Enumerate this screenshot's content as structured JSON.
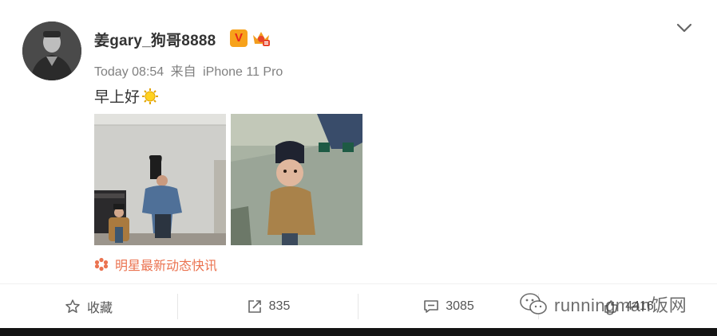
{
  "post": {
    "username": "姜gary_狗哥8888",
    "verified_badge": "V",
    "timestamp": "Today 08:54",
    "source_prefix": "来自",
    "device": "iPhone 11 Pro",
    "text": "早上好",
    "topic_label": "明星最新动态快讯"
  },
  "actions": {
    "favorite_label": "收藏",
    "repost_count": "835",
    "comment_count": "3085",
    "like_count": "4416"
  },
  "watermark": {
    "text": "runningman饭网"
  },
  "icons": {
    "more": "chevron-down-icon",
    "favorite": "star-icon",
    "repost": "repost-icon",
    "comment": "comment-icon",
    "like": "thumbs-up-icon",
    "emoji": "sun-icon",
    "topic": "snowflake-icon"
  },
  "colors": {
    "accent": "#eb7350",
    "badge": "#f7a21b",
    "muted_text": "#808080"
  }
}
